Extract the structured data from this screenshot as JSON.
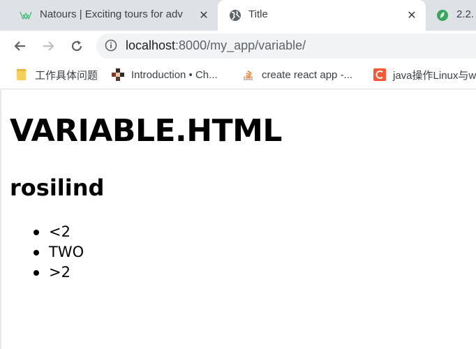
{
  "browser": {
    "tabs": [
      {
        "title": "Natours | Exciting tours for adv",
        "favicon": "natours-logo-icon",
        "active": false
      },
      {
        "title": "Title",
        "favicon": "globe-icon",
        "active": true
      },
      {
        "title": "2.2.",
        "favicon": "green-leaf-icon",
        "active": false
      }
    ],
    "close_glyph": "✕",
    "address": {
      "host": "localhost",
      "path": ":8000/my_app/variable/"
    },
    "bookmarks": [
      {
        "label": "工作具体问题",
        "icon": "folder-icon",
        "color": "#f9cf5b"
      },
      {
        "label": "Introduction • Ch...",
        "icon": "pixel-grid-icon",
        "color": "#7a3b2e"
      },
      {
        "label": "create react app -...",
        "icon": "stackoverflow-icon",
        "color": "#f48024"
      },
      {
        "label": "java操作Linux与w",
        "icon": "csdn-c-icon",
        "color": "#fc5531"
      }
    ]
  },
  "page": {
    "heading": "VARIABLE.HTML",
    "subheading": "rosilind",
    "list_items": [
      "<2",
      "TWO",
      ">2"
    ]
  },
  "colors": {
    "tabstrip": "#dee1e6",
    "omnibox": "#f1f3f4",
    "text": "#000000"
  }
}
